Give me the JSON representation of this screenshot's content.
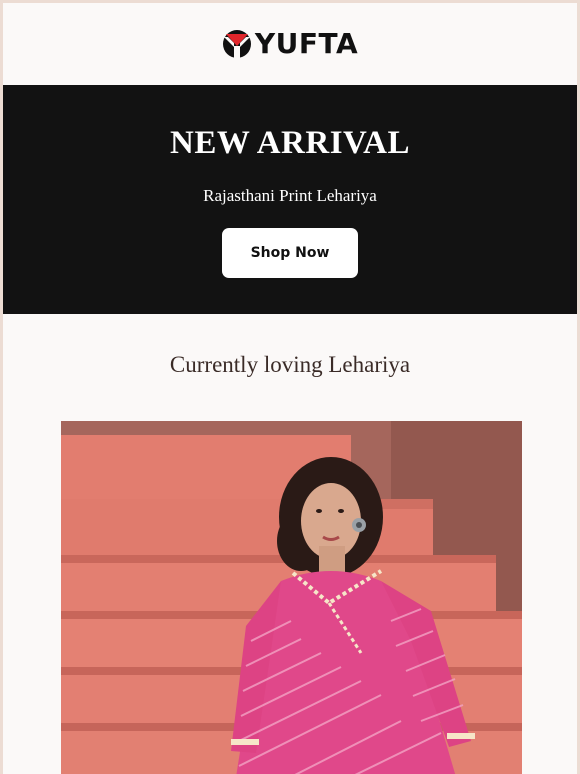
{
  "brand": {
    "name": "YUFTA",
    "logo_icon": "yufta-logo-icon"
  },
  "hero": {
    "title": "NEW ARRIVAL",
    "subtitle": "Rajasthani Print Lehariya",
    "cta_label": "Shop Now"
  },
  "section": {
    "title": "Currently loving Lehariya"
  },
  "colors": {
    "hero_bg": "#121212",
    "page_bg": "#fbf9f8",
    "outer_bg": "#ecdcd3",
    "logo_red": "#e0262b",
    "kurta_pink": "#e0488a",
    "steps_terracotta": "#e27d6f"
  },
  "image": {
    "subject": "model-in-pink-lehariya-kurta"
  }
}
